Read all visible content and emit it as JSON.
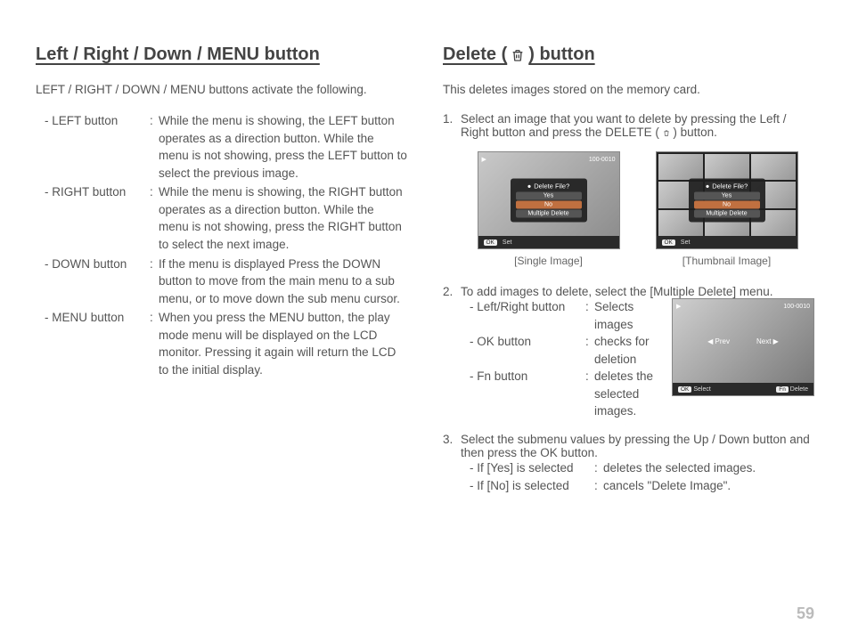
{
  "page_number": "59",
  "left": {
    "title": "Left / Right / Down / MENU button",
    "intro": "LEFT / RIGHT / DOWN / MENU buttons activate the following.",
    "defs": [
      {
        "term": "- LEFT button",
        "body": "While the menu is showing, the LEFT button operates as a direction button. While the menu is not showing, press the LEFT button to select the previous image."
      },
      {
        "term": "- RIGHT button",
        "body": "While the menu is showing, the RIGHT button operates as a direction button. While the menu is not showing, press the RIGHT button to select the next image."
      },
      {
        "term": "- DOWN button",
        "body": "If the menu is displayed Press the DOWN button to move from the main menu to a sub menu, or to move down the sub menu cursor."
      },
      {
        "term": "- MENU button",
        "body": "When you press the MENU button, the play mode menu will be displayed on the LCD monitor. Pressing it again will return the LCD to the initial display."
      }
    ]
  },
  "right": {
    "title_pre": "Delete (",
    "title_post": ") button",
    "intro": "This deletes images stored on the memory card.",
    "step1": {
      "text": "Select an image that you want to delete by pressing the Left / Right button and press the DELETE (",
      "text_end": ") button.",
      "screens": {
        "counter": "100-0010",
        "dialog_title": "Delete File?",
        "opt_yes": "Yes",
        "opt_no": "No",
        "opt_multi": "Multiple Delete",
        "bottom_key": "OK",
        "bottom_label": "Set",
        "cap_single": "[Single Image]",
        "cap_thumb": "[Thumbnail Image]"
      }
    },
    "step2": {
      "text": "To add images to delete, select the [Multiple Delete] menu.",
      "rows": [
        {
          "term": "- Left/Right button",
          "body": "Selects images"
        },
        {
          "term": "- OK button",
          "body": "checks for deletion"
        },
        {
          "term": "- Fn button",
          "body": "deletes the selected images."
        }
      ],
      "screen": {
        "counter": "100-0010",
        "prev": "Prev",
        "next": "Next",
        "k1": "OK",
        "l1": "Select",
        "k2": "Fn",
        "l2": "Delete"
      }
    },
    "step3": {
      "text": "Select the submenu values by pressing the Up / Down button and then press the OK button.",
      "rows": [
        {
          "term": "- If [Yes] is selected",
          "body": "deletes the selected images."
        },
        {
          "term": "- If [No] is selected",
          "body": "cancels \"Delete Image\"."
        }
      ]
    }
  }
}
